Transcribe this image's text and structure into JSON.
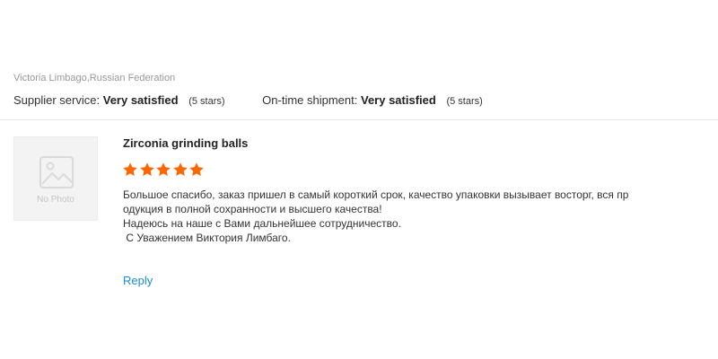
{
  "review": {
    "reviewer": "Victoria Limbago,Russian Federation",
    "supplier_service": {
      "label": "Supplier service:",
      "value": "Very satisfied",
      "stars_text": "(5 stars)"
    },
    "on_time_shipment": {
      "label": "On-time shipment:",
      "value": "Very satisfied",
      "stars_text": "(5 stars)"
    },
    "photo_placeholder": "No Photo",
    "product_title": "Zirconia grinding balls",
    "rating": 5,
    "star_icon": "star-icon",
    "star_color": "#ff6600",
    "comment_lines": [
      "Большое спасибо, заказ пришел в самый короткий срок, качество упаковки вызывает восторг, вся пр",
      "одукция в полной сохранности и высшего качества!",
      "Надеюсь на наше с Вами дальнейшее сотрудничество.",
      " С Уважением Виктория Лимбаго."
    ],
    "reply_label": "Reply",
    "link_color": "#1a8ccf"
  }
}
